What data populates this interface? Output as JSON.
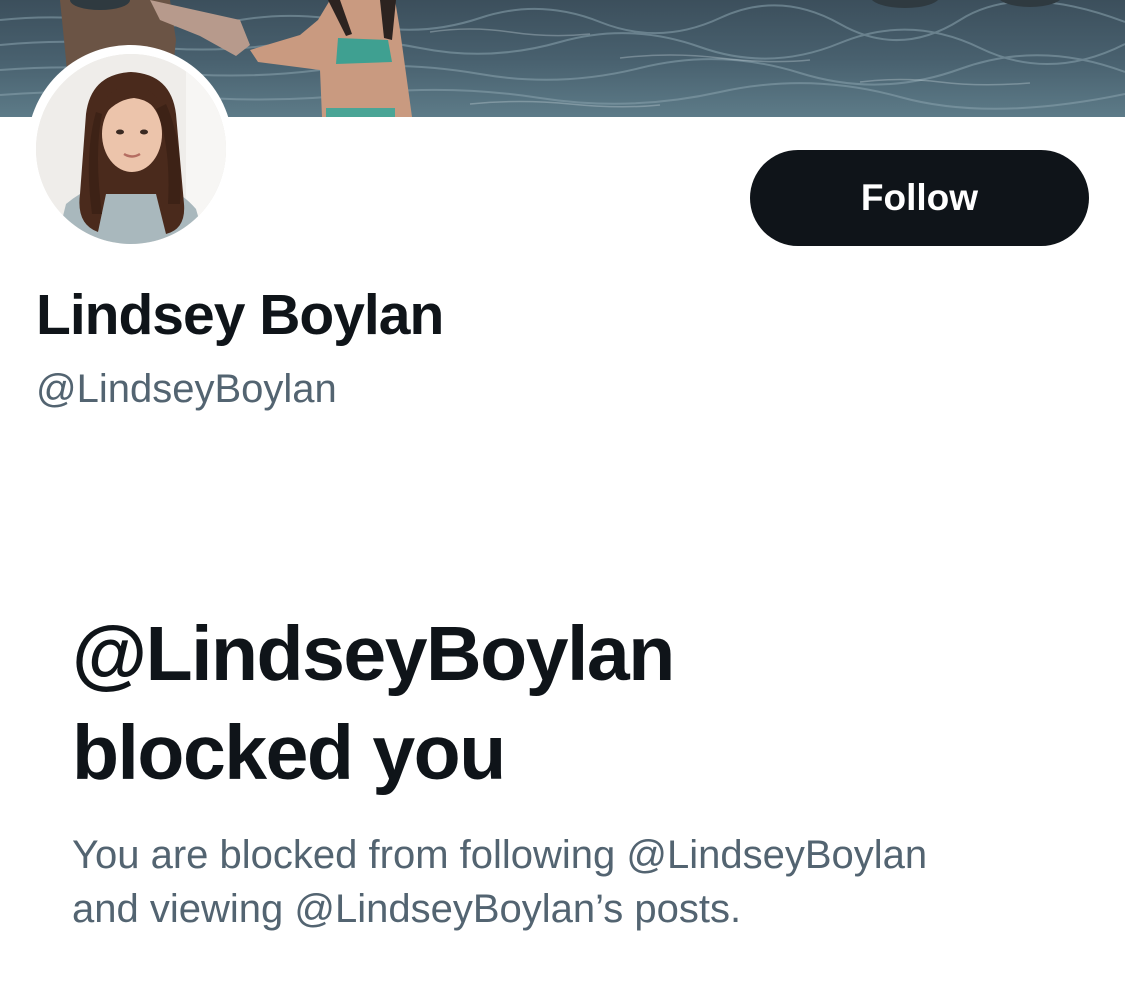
{
  "profile": {
    "display_name": "Lindsey Boylan",
    "handle": "@LindseyBoylan",
    "follow_label": "Follow",
    "banner": "banner-photo",
    "avatar": "avatar-photo"
  },
  "blocked": {
    "title_line1": "@LindseyBoylan",
    "title_line2": "blocked you",
    "desc_line1": "You are blocked from following @LindseyBoylan",
    "desc_line2": "and viewing @LindseyBoylan’s posts."
  },
  "colors": {
    "text_primary": "#0f1419",
    "text_secondary": "#536471",
    "button_bg": "#0f1419",
    "button_text": "#ffffff",
    "background": "#ffffff"
  }
}
